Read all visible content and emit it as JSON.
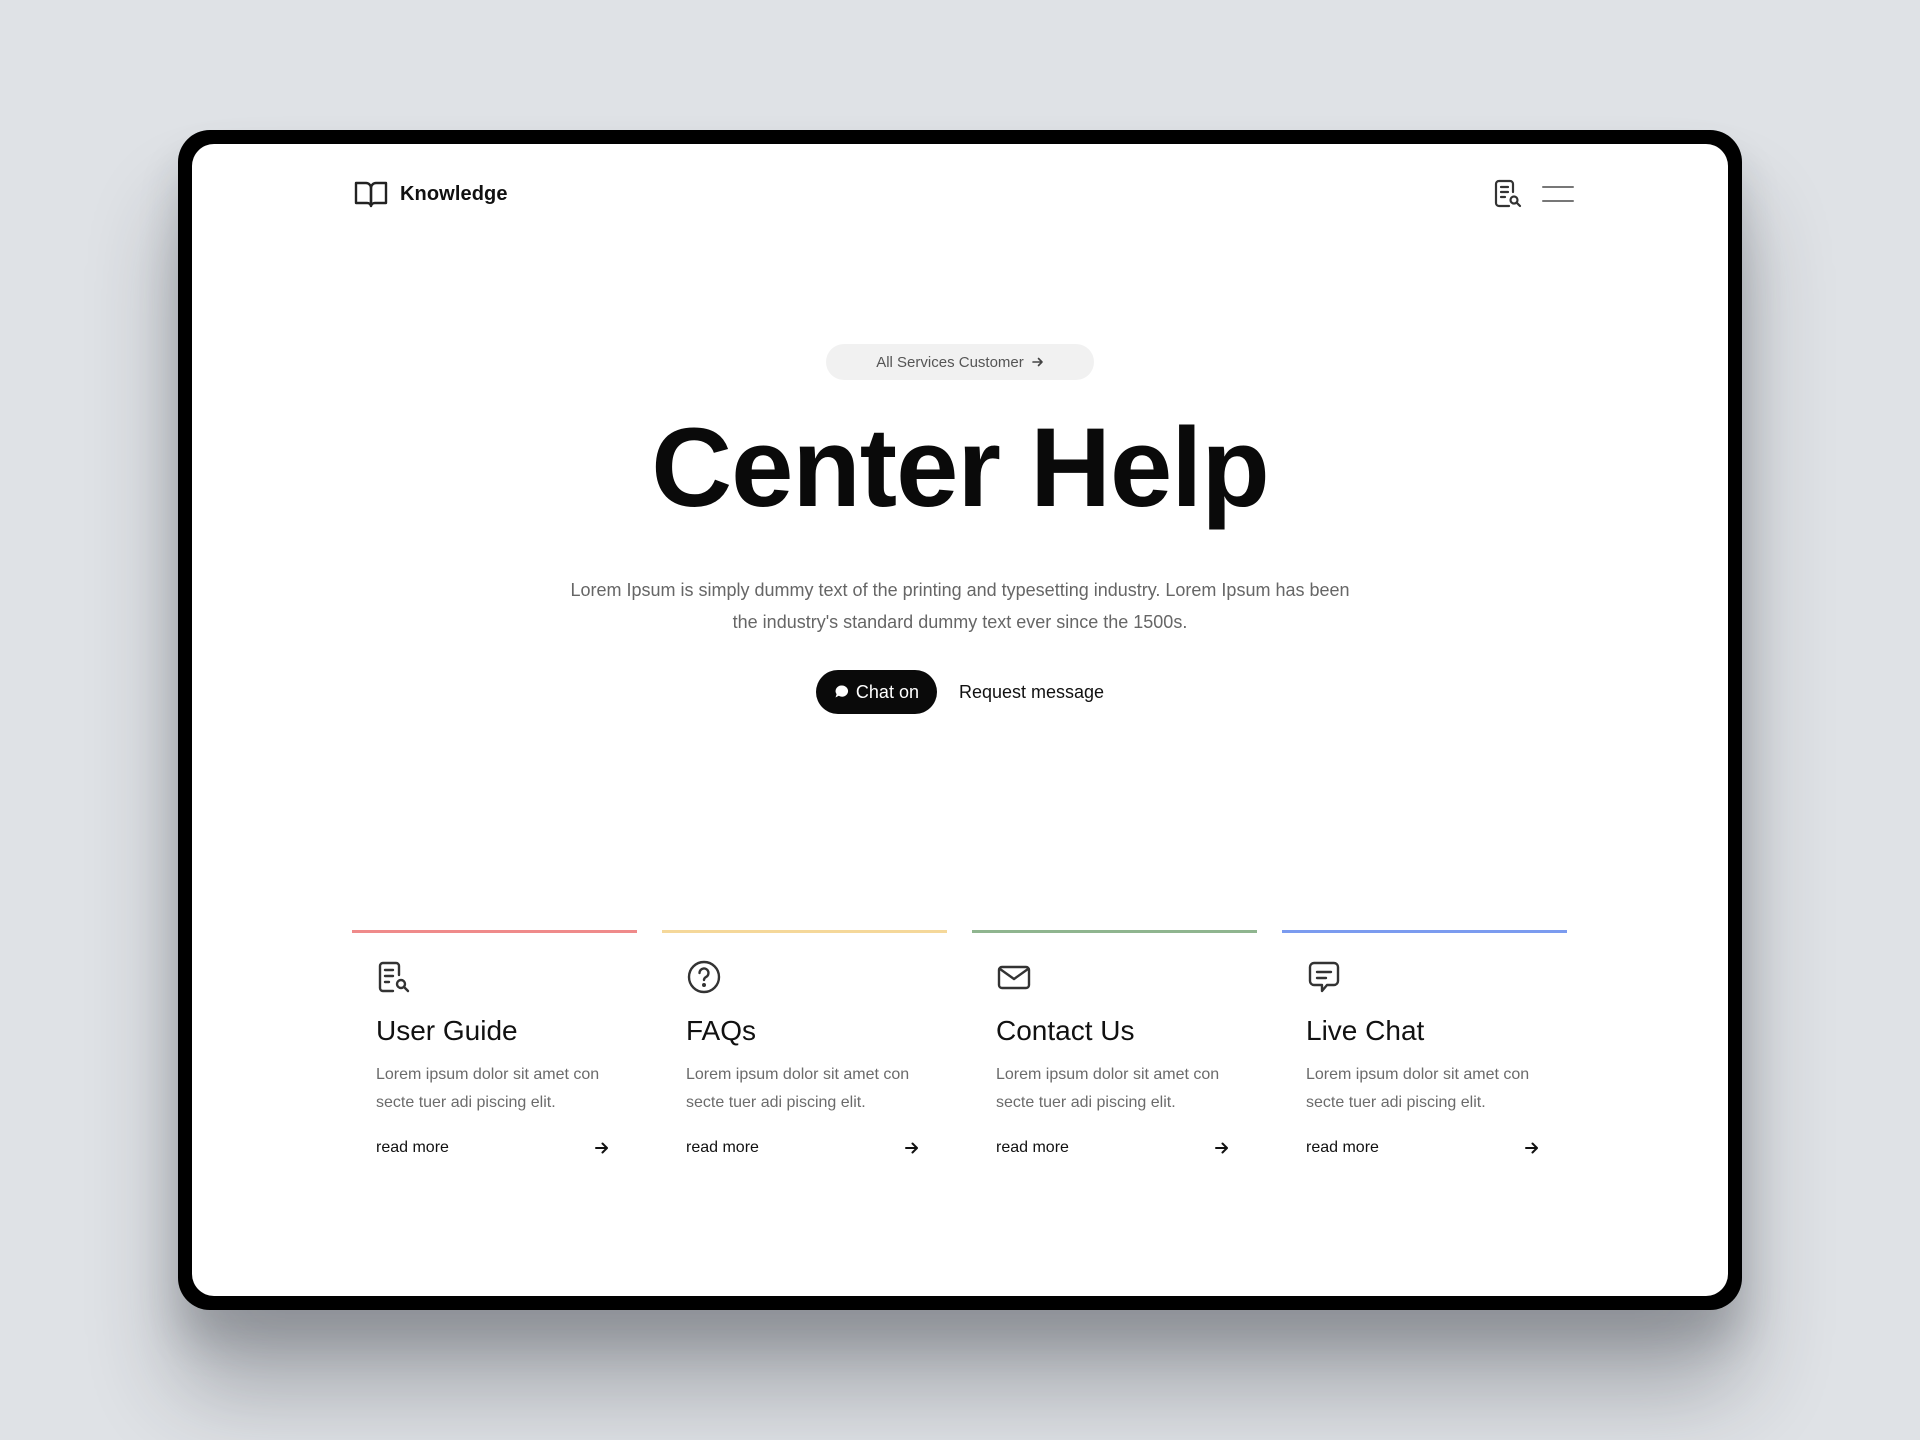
{
  "header": {
    "brand": "Knowledge"
  },
  "hero": {
    "pill_label": "All Services Customer",
    "title": "Center Help",
    "description": "Lorem Ipsum is simply dummy text of the printing and typesetting industry. Lorem Ipsum has been the industry's standard dummy text ever since the 1500s.",
    "chat_button": "Chat on",
    "request_link": "Request message"
  },
  "cards": [
    {
      "title": "User Guide",
      "text": "Lorem ipsum dolor sit amet con secte tuer adi piscing elit.",
      "more": "read more",
      "accent": "#ef8a8a",
      "icon": "document-search-icon"
    },
    {
      "title": "FAQs",
      "text": "Lorem ipsum dolor sit amet con secte tuer adi piscing elit.",
      "more": "read more",
      "accent": "#f5d89a",
      "icon": "question-circle-icon"
    },
    {
      "title": "Contact Us",
      "text": "Lorem ipsum dolor sit amet con secte tuer adi piscing elit.",
      "more": "read more",
      "accent": "#8fb58f",
      "icon": "mail-icon"
    },
    {
      "title": "Live Chat",
      "text": "Lorem ipsum dolor sit amet con secte tuer adi piscing elit.",
      "more": "read more",
      "accent": "#7b9bef",
      "icon": "chat-bubble-icon"
    }
  ]
}
